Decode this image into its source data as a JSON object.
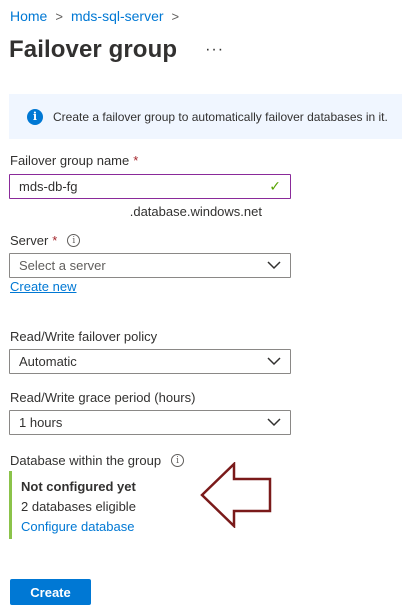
{
  "breadcrumb": {
    "items": [
      "Home",
      "mds-sql-server"
    ],
    "separator": ">"
  },
  "header": {
    "title": "Failover group",
    "more_label": "···"
  },
  "banner": {
    "icon": "info-icon",
    "text": "Create a failover group to automatically failover databases in it."
  },
  "form": {
    "group_name": {
      "label": "Failover group name",
      "required_mark": "*",
      "value": "mds-db-fg",
      "valid_icon": "checkmark-icon",
      "suffix": ".database.windows.net"
    },
    "server": {
      "label": "Server",
      "required_mark": "*",
      "help_icon": "info-circle-icon",
      "placeholder": "Select a server",
      "create_new": "Create new"
    },
    "policy": {
      "label": "Read/Write failover policy",
      "value": "Automatic"
    },
    "grace_period": {
      "label": "Read/Write grace period (hours)",
      "value": "1 hours"
    },
    "databases": {
      "label": "Database within the group",
      "help_icon": "info-circle-icon",
      "status": "Not configured yet",
      "count": "2 databases eligible",
      "configure": "Configure database"
    }
  },
  "actions": {
    "create_label": "Create"
  },
  "colors": {
    "accent": "#0078d4",
    "required": "#a4262c",
    "valid": "#57a300",
    "arrow": "#7a1a1a",
    "db_border": "#8bc34a"
  }
}
